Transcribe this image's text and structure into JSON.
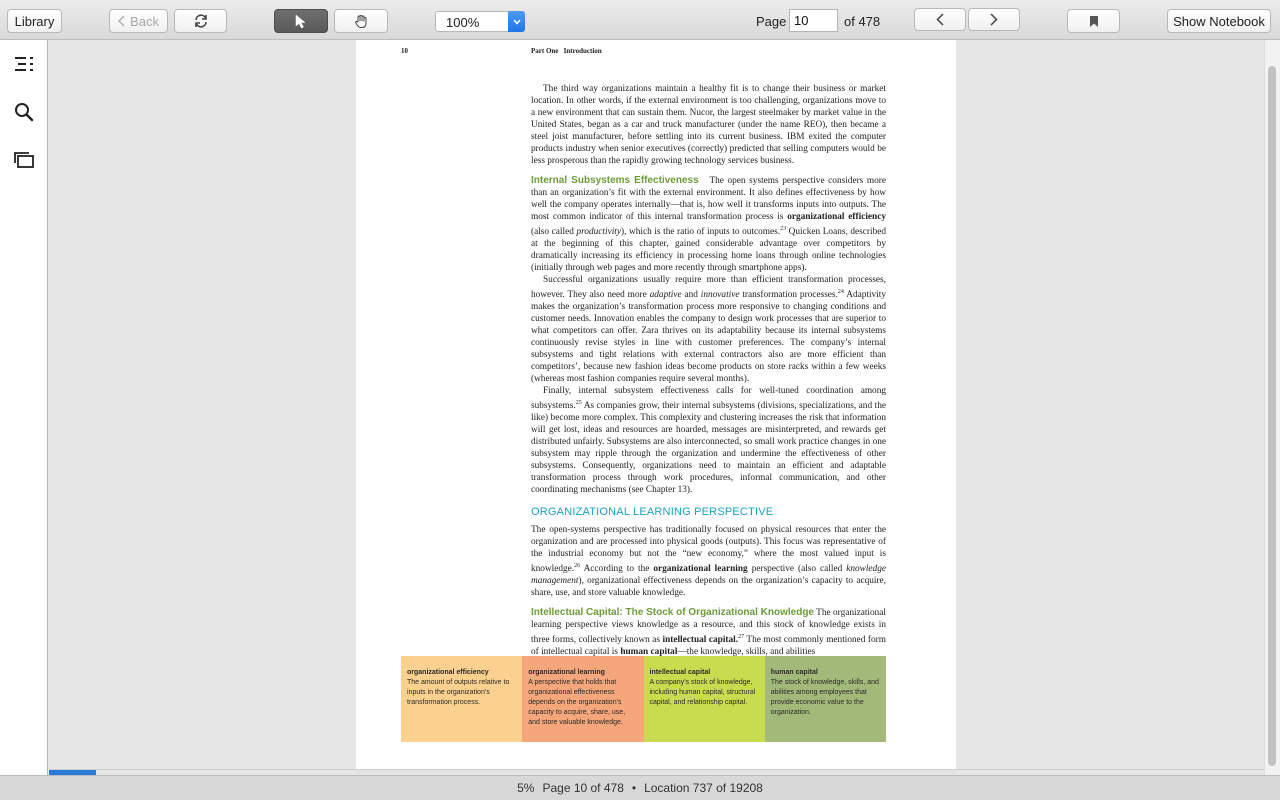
{
  "toolbar": {
    "library_label": "Library",
    "back_label": "Back",
    "zoom_value": "100%",
    "page_label": "Page",
    "page_value": "10",
    "page_total": "of 478",
    "show_notebook_label": "Show Notebook"
  },
  "sidebar": {
    "items": [
      "table-of-contents",
      "search",
      "thumbnails"
    ]
  },
  "book": {
    "page_number": "10",
    "running_head_part": "Part One",
    "running_head_title": "Introduction",
    "para1": "The third way organizations maintain a healthy fit is to change their business or market location. In other words, if the external environment is too challenging, organizations move to a new environment that can sustain them. Nucor, the largest steelmaker by market value in the United States, began as a car and truck manufacturer (under the name REO), then became a steel joist manufacturer, before settling into its current business. IBM exited the computer products industry when senior executives (correctly) predicted that selling computers would be less prosperous than the rapidly growing technology services business.",
    "heading_internal": "Internal Subsystems Effectiveness",
    "para2a": "The open systems perspective considers more than an organization’s fit with the external environment. It also defines effectiveness by how well the company operates internally—that is, how well it transforms inputs into outputs. The most common indicator of this internal transformation process is ",
    "para2_term1": "organizational efficiency",
    "para2b": " (also called ",
    "para2_term2": "productivity",
    "para2c": "), which is the ratio of inputs to outcomes.",
    "para2_ref": "23",
    "para2d": " Quicken Loans, described at the beginning of this chapter, gained considerable advantage over competitors by dramatically increasing its efficiency in processing home loans through online technologies (initially through web pages and more recently through smartphone apps).",
    "para3a": "Successful organizations usually require more than efficient transformation processes, however. They also need more ",
    "para3_term1": "adaptive",
    "para3_and": " and ",
    "para3_term2": "innovative",
    "para3b": " transformation processes.",
    "para3_ref": "24",
    "para3c": " Adaptivity makes the organization’s transformation process more responsive to changing conditions and customer needs. Innovation enables the company to design work processes that are superior to what competitors can offer. Zara thrives on its adaptability because its internal subsystems continuously revise styles in line with customer preferences. The company’s internal subsystems and tight relations with external contractors also are more efficient than competitors’, because new fashion ideas become products on store racks within a few weeks (whereas most fashion companies require several months).",
    "para4a": "Finally, internal subsystem effectiveness calls for well-tuned coordination among subsystems.",
    "para4_ref": "25",
    "para4b": " As companies grow, their internal subsystems (divisions, specializations, and the like) become more complex. This complexity and clustering increases the risk that information will get lost, ideas and resources are hoarded, messages are misinterpreted, and rewards get distributed unfairly. Subsystems are also interconnected, so small work practice changes in one subsystem may ripple through the organization and undermine the effectiveness of other subsystems. Consequently, organizations need to maintain an efficient and adaptable transformation process through work procedures, informal communication, and other coordinating mechanisms (see Chapter 13).",
    "heading_olp": "ORGANIZATIONAL LEARNING PERSPECTIVE",
    "para5a": "The open-systems perspective has traditionally focused on physical resources that enter the organization and are processed into physical goods (outputs). This focus was representative of the industrial economy but not the “new economy,” where the most valued input is knowledge.",
    "para5_ref": "26",
    "para5b": " According to the ",
    "para5_term1": "organizational learning",
    "para5c": " perspective (also called ",
    "para5_term2": "knowledge management",
    "para5d": "), organizational effectiveness depends on the organization’s capacity to acquire, share, use, and store valuable knowledge.",
    "heading_ic": "Intellectual Capital: The Stock of Organizational Knowledge",
    "para6a": " The organizational learning perspective views knowledge as a resource, and this stock of knowledge exists in three forms, collectively known as ",
    "para6_term1": "intellectual capital.",
    "para6_ref": "27",
    "para6b": " The most commonly mentioned form of intellectual capital is ",
    "para6_term2": "human capital",
    "para6c": "—the knowledge, skills, and abilities"
  },
  "glossary": [
    {
      "term": "organizational efficiency",
      "definition": "The amount of outputs relative to inputs in the organization’s transformation process.",
      "color": "#fcd08e"
    },
    {
      "term": "organizational learning",
      "definition": "A perspective that holds that organizational effectiveness depends on the organization’s capacity to acquire, share, use, and store valuable knowledge.",
      "color": "#f5a77b"
    },
    {
      "term": "intellectual capital",
      "definition": "A company’s stock of knowledge, including human capital, structural capital, and relationship capital.",
      "color": "#c9dc4f"
    },
    {
      "term": "human capital",
      "definition": "The stock of knowledge, skills, and abilities among employees that provide economic value to the organization.",
      "color": "#a3b97a"
    }
  ],
  "status": {
    "percent": "5%",
    "page_info": "Page 10 of 478",
    "separator": "•",
    "location": "Location 737 of 19208",
    "progress_fraction": 0.05
  }
}
